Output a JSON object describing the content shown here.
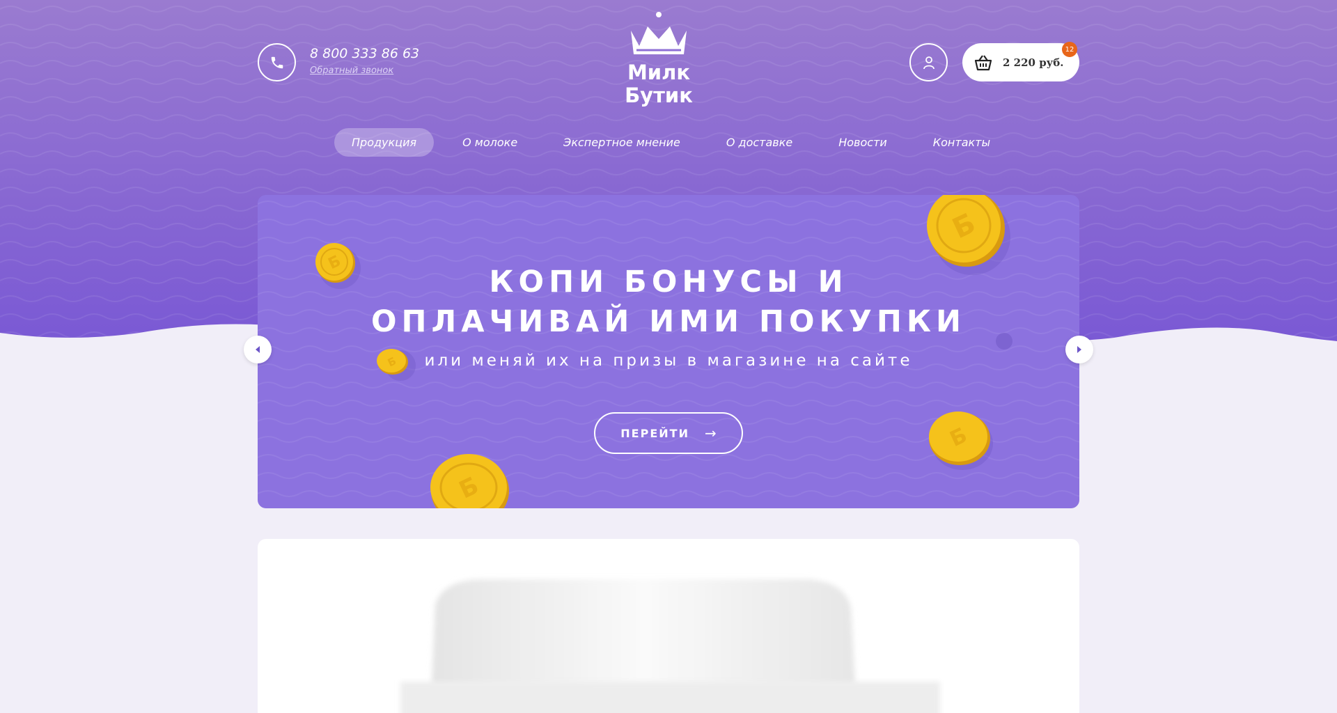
{
  "header": {
    "phone": "8 800 333 86 63",
    "callback_label": "Обратный звонок",
    "logo": {
      "line1": "Милк",
      "line2": "Бутик"
    },
    "cart": {
      "total": "2 220 руб.",
      "count": "12"
    }
  },
  "nav": {
    "items": [
      {
        "label": "Продукция",
        "active": true
      },
      {
        "label": "О молоке",
        "active": false
      },
      {
        "label": "Экспертное мнение",
        "active": false
      },
      {
        "label": "О доставке",
        "active": false
      },
      {
        "label": "Новости",
        "active": false
      },
      {
        "label": "Контакты",
        "active": false
      }
    ]
  },
  "banner": {
    "title_line1": "КОПИ БОНУСЫ И",
    "title_line2": "ОПЛАЧИВАЙ ИМИ ПОКУПКИ",
    "subtitle": "или меняй их на призы в магазине на сайте",
    "button_label": "ПЕРЕЙТИ",
    "coin_letter": "Б"
  },
  "colors": {
    "header_top": "#9a7bd0",
    "header_bottom": "#7a59d4",
    "banner_bg": "#8c72df",
    "page_bg": "#f1eef8",
    "coin": "#f5c21b",
    "badge": "#e8661a"
  },
  "icons": [
    "phone-icon",
    "user-icon",
    "basket-icon",
    "arrow-right-icon",
    "chevron-left-icon",
    "chevron-right-icon",
    "crown-icon"
  ]
}
